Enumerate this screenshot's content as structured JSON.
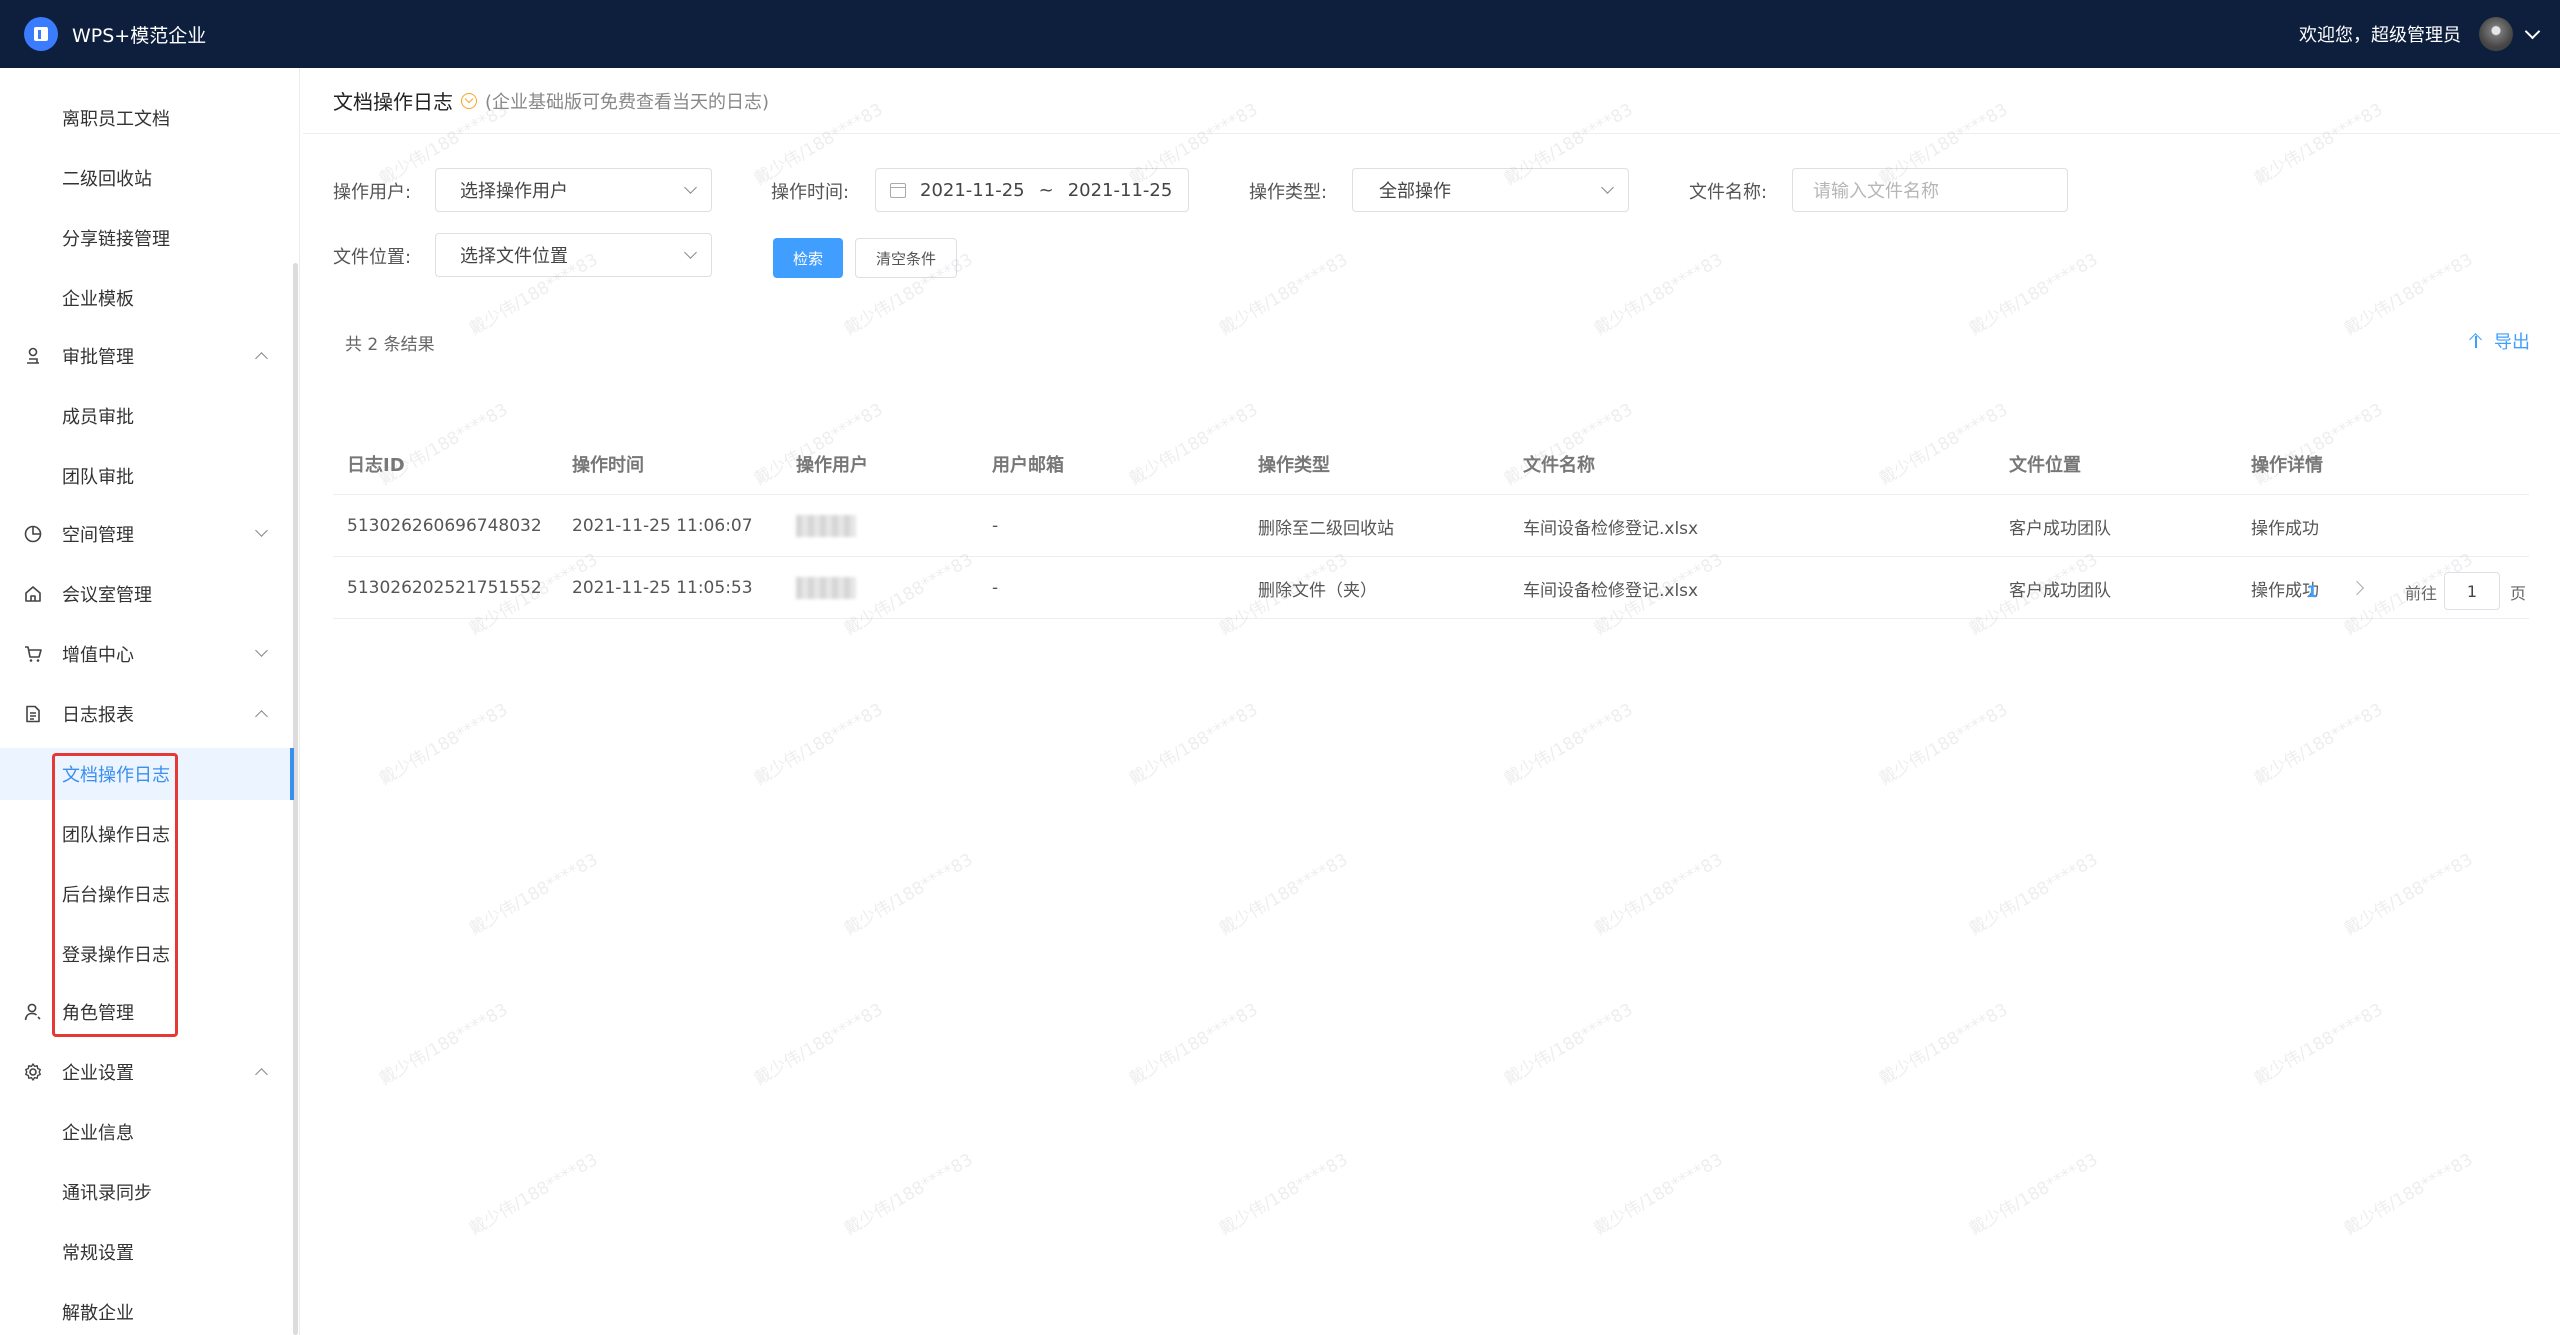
{
  "topbar": {
    "brand": "WPS+模范企业",
    "welcome": "欢迎您，超级管理员"
  },
  "sidebar": {
    "items": [
      {
        "label": "离职员工文档"
      },
      {
        "label": "二级回收站"
      },
      {
        "label": "分享链接管理"
      },
      {
        "label": "企业模板"
      },
      {
        "label": "审批管理"
      },
      {
        "label": "成员审批"
      },
      {
        "label": "团队审批"
      },
      {
        "label": "空间管理"
      },
      {
        "label": "会议室管理"
      },
      {
        "label": "增值中心"
      },
      {
        "label": "日志报表"
      },
      {
        "label": "文档操作日志"
      },
      {
        "label": "团队操作日志"
      },
      {
        "label": "后台操作日志"
      },
      {
        "label": "登录操作日志"
      },
      {
        "label": "角色管理"
      },
      {
        "label": "企业设置"
      },
      {
        "label": "企业信息"
      },
      {
        "label": "通讯录同步"
      },
      {
        "label": "常规设置"
      },
      {
        "label": "解散企业"
      }
    ]
  },
  "page": {
    "title": "文档操作日志",
    "note": "(企业基础版可免费查看当天的日志)"
  },
  "filters": {
    "user_label": "操作用户:",
    "user_value": "选择操作用户",
    "time_label": "操作时间:",
    "time_start": "2021-11-25",
    "time_sep": "~",
    "time_end": "2021-11-25",
    "type_label": "操作类型:",
    "type_value": "全部操作",
    "name_label": "文件名称:",
    "name_placeholder": "请输入文件名称",
    "location_label": "文件位置:",
    "location_value": "选择文件位置",
    "search_button": "检索",
    "clear_button": "清空条件"
  },
  "results": {
    "count": "共 2 条结果",
    "export": "导出"
  },
  "table": {
    "headers": [
      "日志ID",
      "操作时间",
      "操作用户",
      "用户邮箱",
      "操作类型",
      "文件名称",
      "文件位置",
      "操作详情"
    ],
    "rows": [
      {
        "id": "513026260696748032",
        "time": "2021-11-25 11:06:07",
        "email": "-",
        "type": "删除至二级回收站",
        "file": "车间设备检修登记.xlsx",
        "location": "客户成功团队",
        "detail": "操作成功"
      },
      {
        "id": "513026202521751552",
        "time": "2021-11-25 11:05:53",
        "email": "-",
        "type": "删除文件（夹）",
        "file": "车间设备检修登记.xlsx",
        "location": "客户成功团队",
        "detail": "操作成功"
      }
    ]
  },
  "pagination": {
    "current": "1",
    "goto_label": "前往",
    "goto_value": "1",
    "goto_suffix": "页"
  },
  "watermark": "戴少伟/188****83",
  "colors": {
    "topbar": "#0d1f3c",
    "accent": "#409eff",
    "highlight": "#e53935"
  }
}
